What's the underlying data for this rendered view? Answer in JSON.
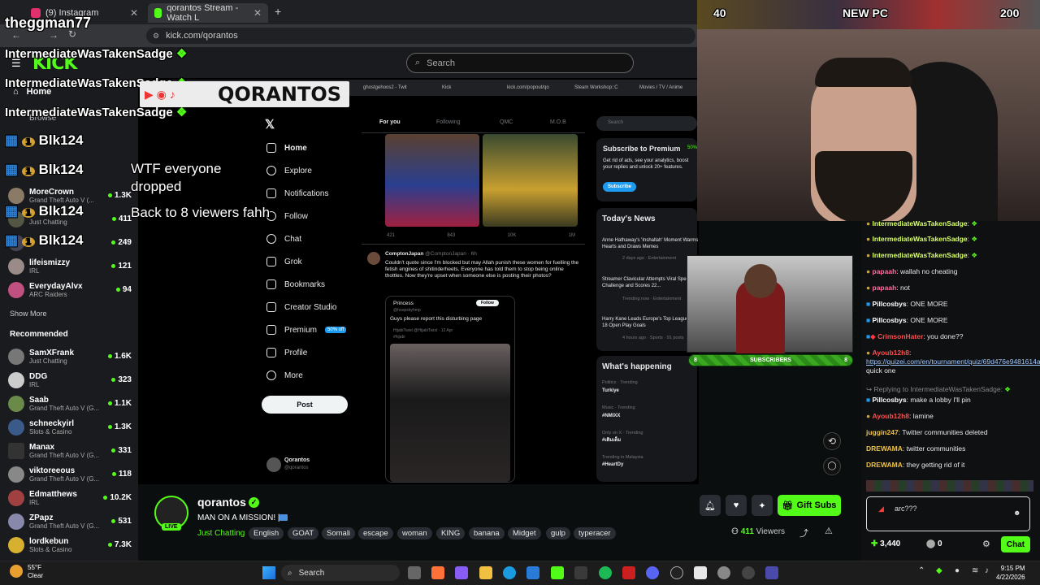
{
  "browser": {
    "tabs": [
      {
        "label": "(9) Instagram",
        "active": false
      },
      {
        "label": "qorantos Stream - Watch L",
        "active": true
      }
    ],
    "new_tab": "+",
    "url": "kick.com/qorantos"
  },
  "kick": {
    "logo": "KICK",
    "search_placeholder": "Search",
    "nav": {
      "home": "Home",
      "browse": "Browse"
    },
    "following": [
      {
        "name": "MoreCrown",
        "category": "Grand Theft Auto V (...",
        "viewers": "1.3K"
      },
      {
        "name": "",
        "category": "Just Chatting",
        "viewers": "411"
      },
      {
        "name": "",
        "category": "",
        "viewers": "249"
      },
      {
        "name": "lifeismizzy",
        "category": "IRL",
        "viewers": "121"
      },
      {
        "name": "EverydayAlvx",
        "category": "ARC Raiders",
        "viewers": "94"
      }
    ],
    "show_more": "Show More",
    "recommended_heading": "Recommended",
    "recommended": [
      {
        "name": "SamXFrank",
        "category": "Just Chatting",
        "viewers": "1.6K"
      },
      {
        "name": "DDG",
        "category": "IRL",
        "viewers": "323"
      },
      {
        "name": "Saab",
        "category": "Grand Theft Auto V (G...",
        "viewers": "1.1K"
      },
      {
        "name": "schneckyirl",
        "category": "Slots & Casino",
        "viewers": "1.3K"
      },
      {
        "name": "Manax",
        "category": "Grand Theft Auto V (G...",
        "viewers": "331"
      },
      {
        "name": "viktoreeous",
        "category": "Grand Theft Auto V (G...",
        "viewers": "118"
      },
      {
        "name": "Edmatthews",
        "category": "IRL",
        "viewers": "10.2K"
      },
      {
        "name": "ZPapz",
        "category": "Grand Theft Auto V (G...",
        "viewers": "531"
      },
      {
        "name": "lordkebun",
        "category": "Slots & Casino",
        "viewers": "7.3K"
      }
    ]
  },
  "stream_inner": {
    "tabs": [
      "ghostgehoos2 - Twit",
      "Kick",
      "kick.com/popout/qo",
      "Steam Workshop::C",
      "Movies / TV / Anime"
    ],
    "x_nav": [
      "Home",
      "Explore",
      "Notifications",
      "Follow",
      "Chat",
      "Grok",
      "Bookmarks",
      "Creator Studio",
      "Premium",
      "Profile",
      "More"
    ],
    "premium_badge": "50% off",
    "post_button": "Post",
    "profile_name": "Qorantos",
    "profile_handle": "@qorantos",
    "feed_tabs": [
      "For you",
      "Following",
      "QMC",
      "M.O.B"
    ],
    "tweet_stats": [
      "421",
      "843",
      "10K",
      "1M"
    ],
    "tweet": {
      "author": "ComptonJapan",
      "handle": "@ComptonJapan · 6h",
      "text": "Couldn't quote since I'm blocked but may Allah punish these women for fuelling the fetish engines of shitinderheets. Everyone has told them to stop being online thottles. Now they're upset when someone else is posting their photos?",
      "quoted_name": "Princess",
      "quoted_handle": "@hoopsbyhmp",
      "quoted_follow": "Follow",
      "quoted_text": "Guys please report this disturbing page",
      "quoted_sub": "HijabiTwist @HijabiTwist · 12 Apr",
      "quoted_sub2": "#hijabi"
    },
    "right_search": "Search",
    "premium_title": "Subscribe to Premium",
    "premium_pct": "50%",
    "premium_text": "Get rid of ads, see your analytics, boost your replies and unlock 20+ features.",
    "premium_button": "Subscribe",
    "news_title": "Today's News",
    "news": [
      {
        "title": "Anne Hathaway's 'Inshallah' Moment Warms Hearts and Draws Memes",
        "meta": "2 days ago · Entertainment"
      },
      {
        "title": "Streamer Clavicular Attempts Viral Speed Challenge and Scores 22...",
        "meta": "Trending now · Entertainment"
      },
      {
        "title": "Harry Kane Leads Europe's Top Leagues with 18 Open Play Goals",
        "meta": "4 hours ago · Sports · 91 posts"
      }
    ],
    "happening_title": "What's happening",
    "happening": [
      {
        "meta": "Politics · Trending",
        "title": "Turkiye"
      },
      {
        "meta": "Music · Trending",
        "title": "#NMIXX"
      },
      {
        "meta": "Only on X · Trending",
        "title": "#เติมเต็ม"
      },
      {
        "meta": "Trending in Malaysia",
        "title": "#HeartDy"
      }
    ],
    "subscribers_label": "SUBSCRIBERS",
    "sub_count_left": "8",
    "sub_count_right": "8"
  },
  "stream": {
    "name": "qorantos",
    "title": "MAN ON A MISSION! |",
    "category": "Just Chatting",
    "tags": [
      "English",
      "GOAT",
      "Somali",
      "escape",
      "woman",
      "KING",
      "banana",
      "Midget",
      "gulp",
      "typeracer"
    ],
    "viewers": "411",
    "viewers_label": "Viewers",
    "gift_subs": "Gift Subs",
    "live": "LIVE"
  },
  "overlays": {
    "watermark": "theggman77",
    "badge_left": "40",
    "badge_center": "NEW PC",
    "badge_right": "200",
    "inner_logo": "QORANTOS",
    "alerts": [
      "IntermediateWasTakenSadge",
      "IntermediateWasTakenSadge",
      "IntermediateWasTakenSadge"
    ],
    "viewer_names": [
      "Blk124",
      "Blk124",
      "Blk124",
      "Blk124"
    ],
    "viewer_badge": "1",
    "message_line1": "WTF everyone",
    "message_line2": "dropped",
    "message_line3": "Back to 8 viewers fahh"
  },
  "chat": {
    "messages": [
      {
        "user": "IntermediateWasTakenSadge",
        "text": "",
        "color": "green"
      },
      {
        "user": "IntermediateWasTakenSadge",
        "text": "",
        "color": "green"
      },
      {
        "user": "IntermediateWasTakenSadge",
        "text": "",
        "color": "green"
      },
      {
        "user": "papaah",
        "text": "wallah no cheating",
        "color": "pink"
      },
      {
        "user": "papaah",
        "text": "not",
        "color": "pink"
      },
      {
        "user": "Pillcosbys",
        "text": "ONE MORE",
        "color": "white"
      },
      {
        "user": "Pillcosbys",
        "text": "ONE MORE",
        "color": "white"
      },
      {
        "user": "CrimsonHater",
        "text": "you done??",
        "color": "red"
      },
      {
        "user": "Ayoub12h8",
        "text": "",
        "color": "red"
      },
      {
        "user": "Pillcosbys",
        "text": "make a lobby I'll pin",
        "color": "white"
      },
      {
        "user": "Ayoub12h8",
        "text": "lamine",
        "color": "red"
      },
      {
        "user": "juggin247",
        "text": "Twitter communities deleted",
        "color": "gold"
      },
      {
        "user": "DREWAMA",
        "text": "twitter communities",
        "color": "gold"
      },
      {
        "user": "DREWAMA",
        "text": "they getting rid of it",
        "color": "gold"
      }
    ],
    "link": "https://quizei.com/en/tournament/quiz/69d476e9481614a6a0bc08e7",
    "link_after": "quick one",
    "reply_to": "Replying to IntermediateWasTakenSadge:",
    "input_value": "arc???",
    "points": "3,440",
    "points_zero": "0",
    "send": "Chat"
  },
  "taskbar": {
    "weather_temp": "55°F",
    "weather_desc": "Clear",
    "search": "Search",
    "time": "9:15 PM",
    "date": "4/22/2026"
  }
}
